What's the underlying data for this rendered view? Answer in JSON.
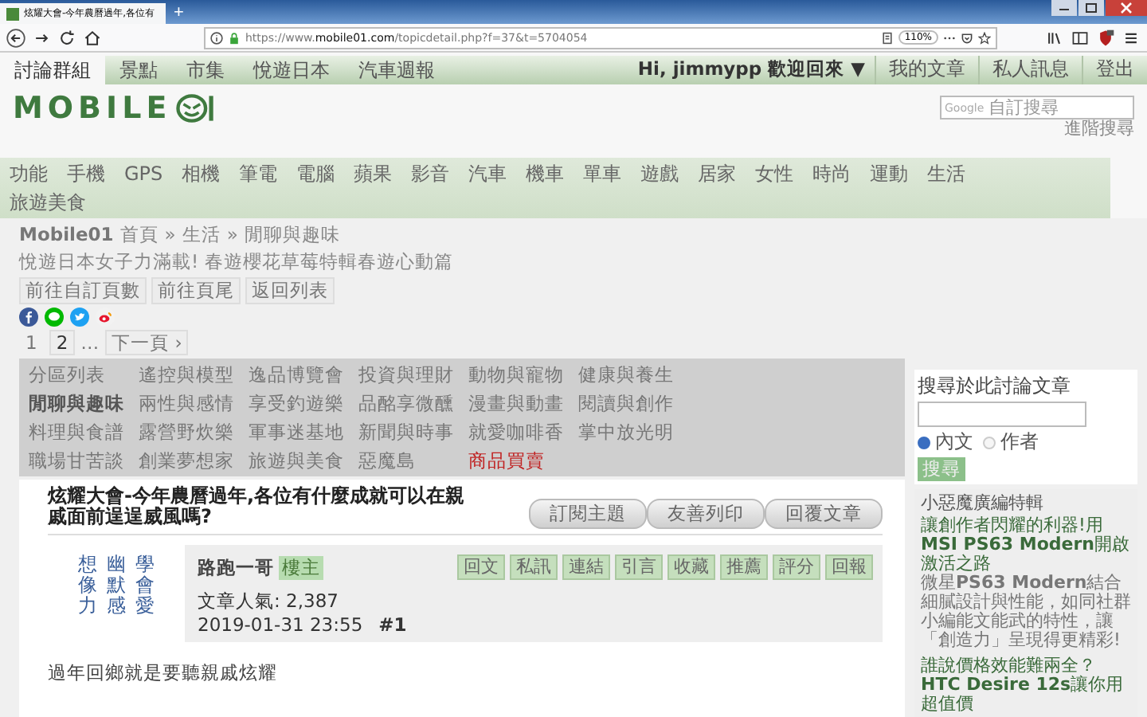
{
  "browser": {
    "tab_title": "炫耀大會-今年農曆過年,各位有",
    "new_tab": "+",
    "url_host": "https://www.",
    "url_domain": "mobile01.com",
    "url_path": "/topicdetail.php?f=37&t=5704054",
    "zoom": "110%"
  },
  "site": {
    "top_tabs": [
      {
        "label": "討論群組",
        "selected": true
      },
      {
        "label": "景點",
        "selected": false
      },
      {
        "label": "市集",
        "selected": false
      },
      {
        "label": "悅遊日本",
        "selected": false
      },
      {
        "label": "汽車週報",
        "selected": false
      }
    ],
    "user_menu": "Hi, jimmypp 歡迎回來 ▼",
    "user_links": [
      "我的文章",
      "私人訊息",
      "登出"
    ],
    "logo": "MOBILE",
    "search": {
      "brand": "Google",
      "placeholder": "自訂搜尋"
    },
    "advanced_search": "進階搜尋",
    "categories": [
      "功能",
      "手機",
      "GPS",
      "相機",
      "筆電",
      "電腦",
      "蘋果",
      "影音",
      "汽車",
      "機車",
      "單車",
      "遊戲",
      "居家",
      "女性",
      "時尚",
      "運動",
      "生活",
      "旅遊美食"
    ]
  },
  "breadcrumb": {
    "site": "Mobile01",
    "items": [
      "首頁",
      "生活",
      "閒聊與趣味"
    ],
    "separator": "»"
  },
  "promo": "悅遊日本女子力滿載! 春遊櫻花草莓特輯春遊心動篇",
  "nav_buttons": [
    "前往自訂頁數",
    "前往頁尾",
    "返回列表"
  ],
  "pagination": {
    "pages": [
      {
        "label": "1",
        "selected": true
      },
      {
        "label": "2",
        "selected": false
      }
    ],
    "ellipsis": "…",
    "next": "下一頁 ›"
  },
  "forums": [
    {
      "label": "分區列表",
      "selected": false,
      "highlight": false
    },
    {
      "label": "遙控與模型",
      "selected": false,
      "highlight": false
    },
    {
      "label": "逸品博覽會",
      "selected": false,
      "highlight": false
    },
    {
      "label": "投資與理財",
      "selected": false,
      "highlight": false
    },
    {
      "label": "動物與寵物",
      "selected": false,
      "highlight": false
    },
    {
      "label": "健康與養生",
      "selected": false,
      "highlight": false
    },
    {
      "label": "閒聊與趣味",
      "selected": true,
      "highlight": false
    },
    {
      "label": "兩性與感情",
      "selected": false,
      "highlight": false
    },
    {
      "label": "享受釣遊樂",
      "selected": false,
      "highlight": false
    },
    {
      "label": "品酩享微醺",
      "selected": false,
      "highlight": false
    },
    {
      "label": "漫畫與動畫",
      "selected": false,
      "highlight": false
    },
    {
      "label": "閱讀與創作",
      "selected": false,
      "highlight": false
    },
    {
      "label": "料理與食譜",
      "selected": false,
      "highlight": false
    },
    {
      "label": "露營野炊樂",
      "selected": false,
      "highlight": false
    },
    {
      "label": "軍事迷基地",
      "selected": false,
      "highlight": false
    },
    {
      "label": "新聞與時事",
      "selected": false,
      "highlight": false
    },
    {
      "label": "就愛咖啡香",
      "selected": false,
      "highlight": false
    },
    {
      "label": "掌中放光明",
      "selected": false,
      "highlight": false
    },
    {
      "label": "職場甘苦談",
      "selected": false,
      "highlight": false
    },
    {
      "label": "創業夢想家",
      "selected": false,
      "highlight": false
    },
    {
      "label": "旅遊與美食",
      "selected": false,
      "highlight": false
    },
    {
      "label": "惡魔島",
      "selected": false,
      "highlight": false
    },
    {
      "label": "商品買賣",
      "selected": false,
      "highlight": true
    }
  ],
  "post": {
    "title": "炫耀大會-今年農曆過年,各位有什麼成就可以在親戚面前逞逞威風嗎?",
    "actions": [
      "訂閱主題",
      "友善列印",
      "回覆文章"
    ],
    "signature_columns": [
      "想像力",
      "幽默感",
      "學會愛"
    ],
    "author": "路跑一哥",
    "author_badge": "樓主",
    "tools": [
      "回文",
      "私訊",
      "連結",
      "引言",
      "收藏",
      "推薦",
      "評分",
      "回報"
    ],
    "popularity": "文章人氣: 2,387",
    "date": "2019-01-31 23:55",
    "number": "#1",
    "body": "過年回鄉就是要聽親戚炫耀"
  },
  "sidebar": {
    "search_title": "搜尋於此討論文章",
    "scopes": [
      {
        "label": "內文",
        "selected": true
      },
      {
        "label": "作者",
        "selected": false
      }
    ],
    "search_button": "搜尋",
    "ad_heading": "小惡魔廣編特輯",
    "ads": [
      {
        "title": "讓創作者閃耀的利器!用**MSI PS63 Modern**開啟激活之路",
        "body": "微星**PS63 Modern**結合細膩設計與性能，如同社群小編能文能武的特性，讓「創造力」呈現得更精彩!"
      },
      {
        "title": "誰說價格效能難兩全？**HTC Desire 12s**讓你用超值價"
      }
    ]
  }
}
